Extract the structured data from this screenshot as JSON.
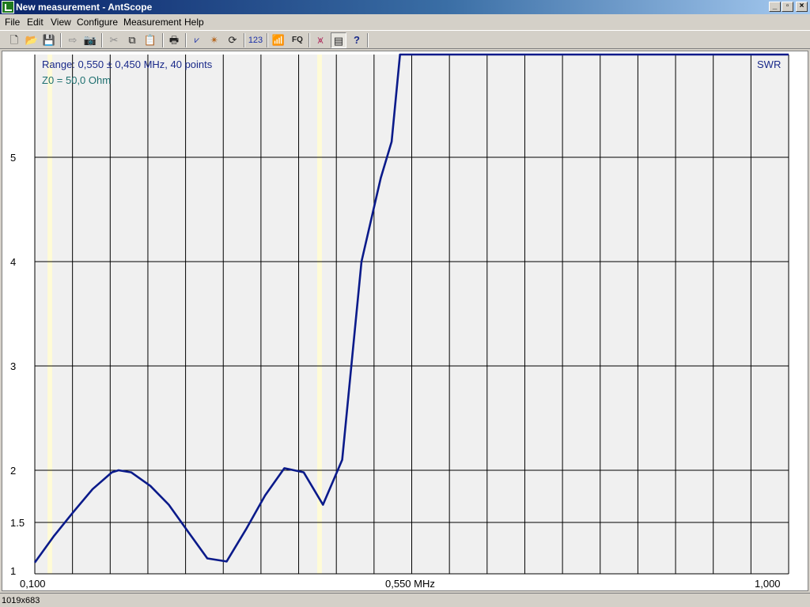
{
  "window": {
    "title": "New measurement - AntScope"
  },
  "titlebar_buttons": {
    "minimize": "_",
    "restore": "▫",
    "close": "×"
  },
  "menu": [
    {
      "label": "File"
    },
    {
      "label": "Edit"
    },
    {
      "label": "View"
    },
    {
      "label": "Configure"
    },
    {
      "label": "Measurement"
    },
    {
      "label": "Help"
    }
  ],
  "toolbar": {
    "icons": [
      "new-file-icon",
      "open-folder-icon",
      "save-icon",
      "export-icon",
      "camera-icon",
      "cut-icon",
      "copy-icon",
      "paste-icon",
      "print-icon",
      "swr-graph-icon",
      "star-icon",
      "refresh-icon",
      "numbers-icon",
      "antenna-icon",
      "fq-icon",
      "dual-curve-icon",
      "table-icon",
      "help-icon"
    ],
    "numbers_label": "123",
    "fq_label": "FQ"
  },
  "plot": {
    "range_info": "Range: 0,550 ± 0,450 MHz, 40 points",
    "z0_info": "Z0 = 50,0 Ohm",
    "curve_label": "SWR",
    "y_ticks": [
      "5",
      "4",
      "3",
      "2",
      "1.5",
      "1"
    ],
    "x_ticks": [
      "0,100",
      "0,550 MHz",
      "1,000"
    ],
    "colors": {
      "curve": "#0a1a8a",
      "grid": "#000000",
      "background": "#f0f0f0",
      "marker": "#fffbd6"
    }
  },
  "chart_data": {
    "type": "line",
    "title": "",
    "xlabel": "MHz",
    "ylabel": "SWR",
    "xlim": [
      0.1,
      1.0
    ],
    "y_ticks": [
      1,
      1.5,
      2,
      3,
      4,
      5
    ],
    "series": [
      {
        "name": "SWR",
        "x": [
          0.1,
          0.123,
          0.146,
          0.169,
          0.192,
          0.2,
          0.215,
          0.238,
          0.26,
          0.283,
          0.306,
          0.329,
          0.352,
          0.375,
          0.398,
          0.421,
          0.444,
          0.467,
          0.49,
          0.513,
          0.526,
          0.536,
          0.55,
          0.572,
          0.6,
          0.7,
          0.8,
          0.9,
          1.0
        ],
        "y": [
          1.11,
          1.37,
          1.6,
          1.82,
          1.98,
          2.0,
          1.98,
          1.85,
          1.67,
          1.41,
          1.15,
          1.12,
          1.43,
          1.76,
          2.02,
          1.98,
          1.67,
          2.1,
          4.0,
          4.8,
          5.15,
          6.0,
          6.0,
          6.0,
          6.0,
          6.0,
          6.0,
          6.0,
          6.0
        ]
      }
    ],
    "markers": [
      0.118,
      0.44
    ],
    "grid": true,
    "legend": "top-right"
  },
  "status": {
    "text": "1019x683"
  }
}
